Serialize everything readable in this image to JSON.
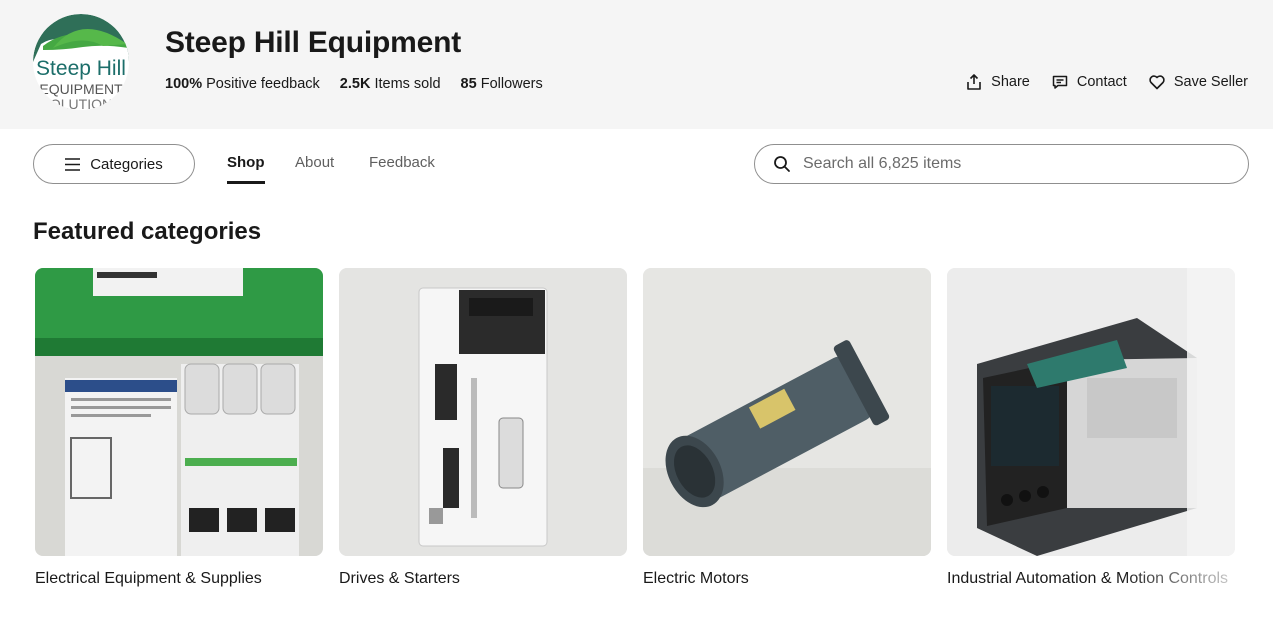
{
  "store": {
    "name": "Steep Hill Equipment",
    "logo": {
      "line1": "Steep Hill",
      "line2": "EQUIPMENT",
      "line3": "SOLUTIONS"
    },
    "stats": [
      {
        "value": "100%",
        "label": "Positive feedback"
      },
      {
        "value": "2.5K",
        "label": "Items sold"
      },
      {
        "value": "85",
        "label": "Followers"
      }
    ],
    "actions": [
      {
        "label": "Share",
        "icon": "share-icon"
      },
      {
        "label": "Contact",
        "icon": "chat-icon"
      },
      {
        "label": "Save Seller",
        "icon": "heart-icon"
      }
    ]
  },
  "nav": {
    "categories_label": "Categories",
    "tabs": [
      {
        "label": "Shop",
        "active": true
      },
      {
        "label": "About",
        "active": false
      },
      {
        "label": "Feedback",
        "active": false
      }
    ],
    "search_placeholder": "Search all 6,825 items"
  },
  "featured": {
    "title": "Featured categories",
    "cards": [
      {
        "label": "Electrical Equipment & Supplies"
      },
      {
        "label": "Drives & Starters"
      },
      {
        "label": "Electric Motors"
      },
      {
        "label": "Industrial Automation & Motion Controls"
      }
    ]
  },
  "colors": {
    "header_bg": "#f5f5f5",
    "text": "#191919",
    "logo_green": "#3a8f3f",
    "logo_teal": "#1c6e6a"
  }
}
